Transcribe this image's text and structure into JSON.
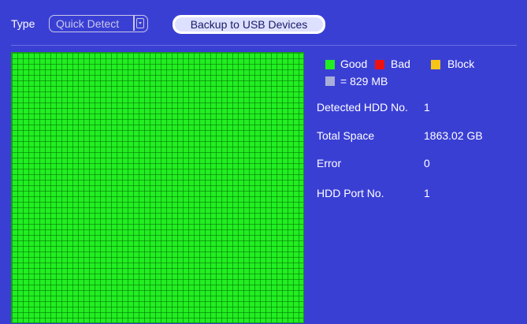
{
  "toolbar": {
    "type_label": "Type",
    "type_select_value": "Quick Detect",
    "backup_label": "Backup to USB Devices"
  },
  "legend": {
    "good_label": "Good",
    "bad_label": "Bad",
    "block_label": "Block",
    "unit_label": "= 829 MB",
    "colors": {
      "good": "#22ee22",
      "bad": "#ee1111",
      "block": "#f5c518",
      "unit": "#a8aed8"
    }
  },
  "info": {
    "detected_hdd_label": "Detected HDD No.",
    "detected_hdd_value": "1",
    "total_space_label": "Total Space",
    "total_space_value": "1863.02 GB",
    "error_label": "Error",
    "error_value": "0",
    "hdd_port_label": "HDD Port No.",
    "hdd_port_value": "1"
  }
}
